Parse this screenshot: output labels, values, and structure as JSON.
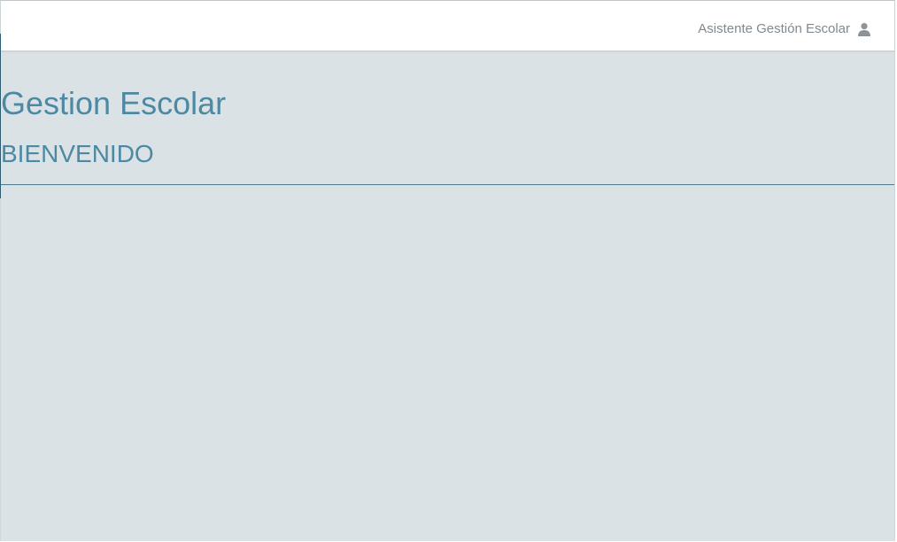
{
  "header": {
    "user_name": "Asistente Gestión Escolar",
    "user_icon": "user-icon"
  },
  "main": {
    "title": "Gestion Escolar",
    "subtitle": "BIENVENIDO"
  },
  "colors": {
    "accent": "#4d89a3",
    "background": "#dae2e5",
    "divider": "#4b7a8e",
    "header_text": "#7f8a91"
  }
}
